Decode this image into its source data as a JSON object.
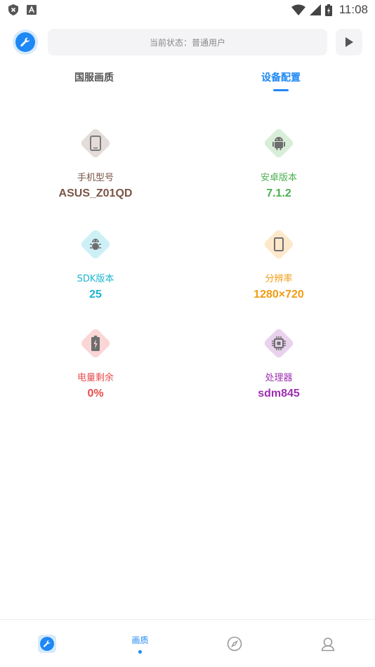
{
  "status_bar": {
    "time": "11:08"
  },
  "header": {
    "status_text": "当前状态：普通用户"
  },
  "tabs": [
    {
      "label": "国服画质"
    },
    {
      "label": "设备配置"
    }
  ],
  "device_info": [
    {
      "label": "手机型号",
      "value": "ASUS_Z01QD",
      "color": "#7a5548",
      "bg": "#e3dcd9",
      "icon": "phone-icon"
    },
    {
      "label": "安卓版本",
      "value": "7.1.2",
      "color": "#4caf50",
      "bg": "#d9eed9",
      "icon": "android-icon"
    },
    {
      "label": "SDK版本",
      "value": "25",
      "color": "#1cb5d0",
      "bg": "#cdf0f6",
      "icon": "bug-icon"
    },
    {
      "label": "分辨率",
      "value": "1280×720",
      "color": "#f29b12",
      "bg": "#fde8cb",
      "icon": "tablet-icon"
    },
    {
      "label": "电量剩余",
      "value": "0%",
      "color": "#e84c4c",
      "bg": "#fbd6d6",
      "icon": "battery-icon"
    },
    {
      "label": "处理器",
      "value": "sdm845",
      "color": "#9c2fb0",
      "bg": "#e9d2ee",
      "icon": "cpu-icon"
    }
  ],
  "bottom_nav": {
    "active_label": "画质"
  },
  "colors": {
    "accent": "#1e88f5"
  }
}
